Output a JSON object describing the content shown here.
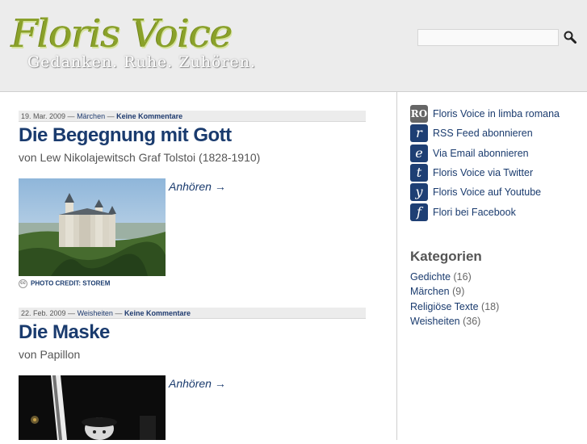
{
  "header": {
    "logo_title": "Floris Voice",
    "logo_tagline": "Gedanken. Ruhe. Zuhören.",
    "search_placeholder": ""
  },
  "posts": [
    {
      "date": "19. Mar. 2009",
      "category": "Märchen",
      "comments": "Keine Kommentare",
      "title": "Die Begegnung mit Gott",
      "byline": "von Lew Nikolajewitsch Graf Tolstoi (1828-1910)",
      "listen_label": "Anhören →",
      "photo_credit": "PHOTO CREDIT: STOREM"
    },
    {
      "date": "22. Feb. 2009",
      "category": "Weisheiten",
      "comments": "Keine Kommentare",
      "title": "Die Maske",
      "byline": "von Papillon",
      "listen_label": "Anhören →"
    }
  ],
  "sidebar": {
    "social": [
      {
        "icon": "RO",
        "icon_name": "romanian-flag-icon",
        "label": "Floris Voice in limba romana"
      },
      {
        "icon": "r",
        "icon_name": "rss-icon",
        "label": "RSS Feed abonnieren"
      },
      {
        "icon": "e",
        "icon_name": "email-icon",
        "label": "Via Email abonnieren"
      },
      {
        "icon": "t",
        "icon_name": "twitter-icon",
        "label": "Floris Voice via Twitter"
      },
      {
        "icon": "y",
        "icon_name": "youtube-icon",
        "label": "Floris Voice auf Youtube"
      },
      {
        "icon": "f",
        "icon_name": "facebook-icon",
        "label": "Flori bei Facebook"
      }
    ],
    "categories_heading": "Kategorien",
    "categories": [
      {
        "name": "Gedichte",
        "count": "(16)"
      },
      {
        "name": "Märchen",
        "count": "(9)"
      },
      {
        "name": "Religiöse Texte",
        "count": "(18)"
      },
      {
        "name": "Weisheiten",
        "count": "(36)"
      }
    ]
  },
  "colors": {
    "link": "#1a3b6e",
    "logo_green": "#8aa12a",
    "icon_blue": "#1e3f74"
  }
}
